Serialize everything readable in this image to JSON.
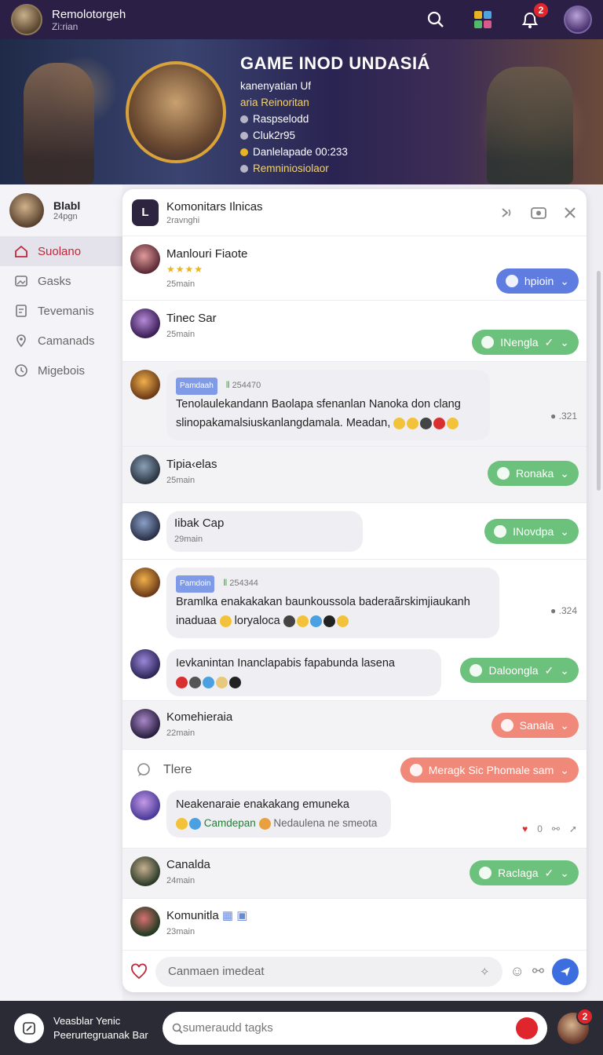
{
  "topbar": {
    "username": "Remolotorgeh",
    "subtitle": "Zi:rian",
    "notif_count": "2"
  },
  "banner": {
    "title": "GAME INOD UNDASIÁ",
    "lines": [
      "kanenyatian Uf",
      "aria Reinoritan",
      "Raspselodd",
      "Cluk2r95",
      "Danlelapade 00:233",
      "Remniniosiolaor"
    ]
  },
  "sidebar": {
    "profile_name": "Blabl",
    "profile_sub": "24pgn",
    "items": [
      "Suolano",
      "Gasks",
      "Tevemanis",
      "Camanads",
      "Migebois"
    ]
  },
  "panel": {
    "title": "Komonitars Ilnicas",
    "subtitle": "2ravnghi",
    "rows": [
      {
        "name": "Manlouri Fiaote",
        "time": "25main",
        "stars": "★★★★",
        "pill": "hpioin"
      },
      {
        "name": "Tinec Sar",
        "time": "25main",
        "pill": "INengla"
      },
      {
        "tag": "Pamdaah",
        "count_tag": "254470",
        "text1": "Tenolaulekandann Baolapa sfenanlan Nanoka don clang",
        "text2": "slinopakamalsiuskanlangdamala. Meadan,",
        "meta": "321"
      },
      {
        "name": "Tipia‹elas",
        "time": "25main",
        "pill": "Ronaka"
      },
      {
        "name": "Iibak Cap",
        "time": "29main",
        "pill": "INovdpa"
      },
      {
        "tag": "Pamdoin",
        "count_tag": "254344",
        "text1": "Bramlka enakakakan baunkoussola baderaãrskimjiaukanh",
        "text2": "inaduaa",
        "text2b": "loryaloca",
        "meta": "324"
      },
      {
        "text1": "Ievkanintan Inanclapabis fapabunda lasena",
        "pill": "Daloongla"
      },
      {
        "name": "Komehieraia",
        "time": "22main",
        "pill": "Sanala"
      },
      {
        "name": "Tlere",
        "pill": "Meragk Sic Phomale sam"
      },
      {
        "text1": "Neakenaraie enakakang emuneka",
        "sub1": "Camdepan",
        "sub2": "Nedaulena ne smeota",
        "meta": "0"
      },
      {
        "name": "Canalda",
        "time": "24main",
        "pill": "Raclaga"
      },
      {
        "name": "Komunitla",
        "time": "23main"
      }
    ],
    "input_placeholder": "Canmaen imedeat"
  },
  "bottombar": {
    "line1": "Veasblar Yenic",
    "line2": "Peerurtegruanak Bar",
    "search_placeholder": "sumeraudd tagks",
    "badge": "2"
  }
}
